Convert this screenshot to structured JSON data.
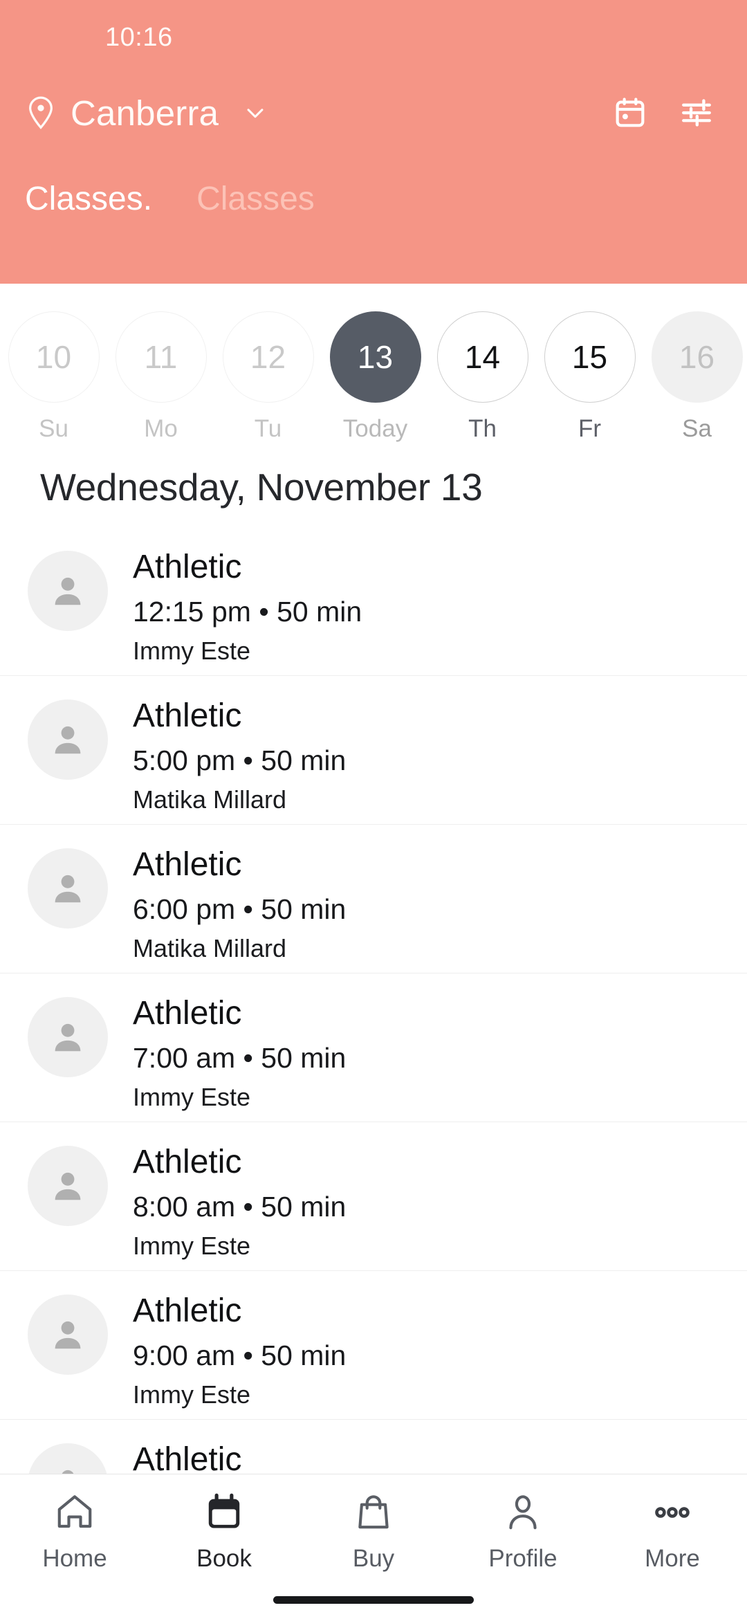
{
  "status_bar": {
    "time": "10:16"
  },
  "header": {
    "location": "Canberra",
    "location_icon": "location-pin-icon",
    "dropdown_icon": "chevron-down-icon",
    "actions": [
      {
        "name": "calendar-icon",
        "label": "Calendar"
      },
      {
        "name": "filter-sliders-icon",
        "label": "Filters"
      }
    ],
    "tabs": [
      {
        "label": "Classes.",
        "active": true
      },
      {
        "label": "Classes",
        "active": false
      }
    ],
    "background_color": "#f59586"
  },
  "date_strip": {
    "days": [
      {
        "date": "10",
        "weekday": "Su",
        "state": "past"
      },
      {
        "date": "11",
        "weekday": "Mo",
        "state": "past"
      },
      {
        "date": "12",
        "weekday": "Tu",
        "state": "past"
      },
      {
        "date": "13",
        "weekday": "Today",
        "state": "today"
      },
      {
        "date": "14",
        "weekday": "Th",
        "state": "future"
      },
      {
        "date": "15",
        "weekday": "Fr",
        "state": "future"
      },
      {
        "date": "16",
        "weekday": "Sa",
        "state": "edge"
      }
    ],
    "selected_color": "#565c66"
  },
  "main": {
    "date_heading": "Wednesday, November 13",
    "classes": [
      {
        "name": "Athletic",
        "meta": "12:15 pm • 50 min",
        "coach": "Immy Este",
        "avatar": "person-avatar-icon"
      },
      {
        "name": "Athletic",
        "meta": "5:00 pm • 50 min",
        "coach": "Matika Millard",
        "avatar": "person-avatar-icon"
      },
      {
        "name": "Athletic",
        "meta": "6:00 pm • 50 min",
        "coach": "Matika Millard",
        "avatar": "person-avatar-icon"
      },
      {
        "name": "Athletic",
        "meta": "7:00 am • 50 min",
        "coach": "Immy Este",
        "avatar": "person-avatar-icon"
      },
      {
        "name": "Athletic",
        "meta": "8:00 am • 50 min",
        "coach": "Immy Este",
        "avatar": "person-avatar-icon"
      },
      {
        "name": "Athletic",
        "meta": "9:00 am • 50 min",
        "coach": "Immy Este",
        "avatar": "person-avatar-icon"
      },
      {
        "name": "Athletic",
        "meta": "",
        "coach": "",
        "avatar": "person-avatar-icon"
      }
    ]
  },
  "bottom_nav": {
    "items": [
      {
        "label": "Home",
        "icon": "home-icon",
        "active": false
      },
      {
        "label": "Book",
        "icon": "calendar-icon",
        "active": true
      },
      {
        "label": "Buy",
        "icon": "shopping-bag-icon",
        "active": false
      },
      {
        "label": "Profile",
        "icon": "person-icon",
        "active": false
      },
      {
        "label": "More",
        "icon": "ellipsis-icon",
        "active": false
      }
    ]
  }
}
